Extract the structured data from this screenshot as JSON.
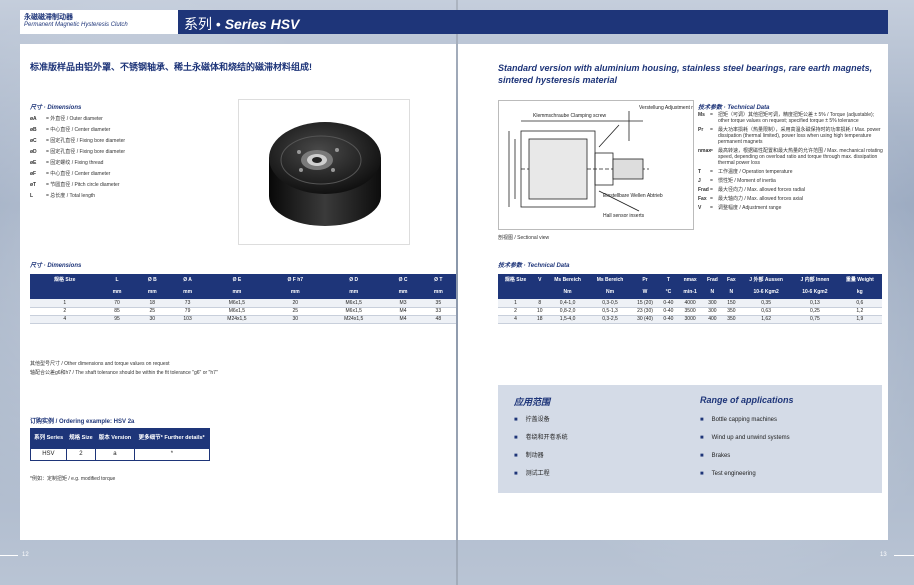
{
  "header": {
    "zh_label": "永磁磁滞制动器",
    "en_label": "Permanent Magnetic Hysteresis Clutch",
    "title_prefix": "系列 • ",
    "title_series": "Series HSV"
  },
  "intro": {
    "zh": "标准版样品由铝外罩、不锈钢轴承、稀土永磁体和烧结的磁滞材料组成!",
    "en": "Standard version with aluminium housing, stainless steel bearings, rare earth magnets, sintered hysteresis material"
  },
  "dimensions_legend": {
    "title": "尺寸 · Dimensions",
    "items": [
      {
        "sym": "øA",
        "text": "= 外直径 / Outer diameter"
      },
      {
        "sym": "øB",
        "text": "= 中心直径 / Center diameter"
      },
      {
        "sym": "øC",
        "text": "= 固定孔直径 / Fixing bore diameter"
      },
      {
        "sym": "øD",
        "text": "= 固定孔直径 / Fixing bore diameter"
      },
      {
        "sym": "øE",
        "text": "= 固定螺纹 / Fixing thread"
      },
      {
        "sym": "øF",
        "text": "= 中心直径 / Center diameter"
      },
      {
        "sym": "øT",
        "text": "= 节圆直径 / Pitch circle diameter"
      },
      {
        "sym": "L",
        "text": "= 总长度 / Total length"
      }
    ]
  },
  "drawing": {
    "labels": [
      "Verstellung Adjustment range",
      "Klemmschraube Clamping screw",
      "Einstellbare Wellen Abtrieb",
      "Hall sensor inserts"
    ],
    "caption": "剖视图 / Sectional view"
  },
  "tech_legend": {
    "title": "技术参数 · Technical Data",
    "items": [
      {
        "sym": "Ms",
        "text": "扭矩（可调）其他扭矩可调，精度扭矩公差 ± 5% / Torque (adjustable); other torque values on request; specified torque ± 5% tolerance"
      },
      {
        "sym": "Pr",
        "text": "最大功率损耗（热量限制），采用高温永磁保持时的功率损耗 / Max. power dissipation (thermal limited), power loss when using high temperature permanent magnets"
      },
      {
        "sym": "nmax",
        "text": "最高转速，根据磁性配置和最大热量的允许范围 / Max. mechanical rotating speed, depending on overload ratio and torque through max. dissipation thermal power loss"
      },
      {
        "sym": "T",
        "text": "工作温度 / Operation temperature"
      },
      {
        "sym": "J",
        "text": "惯性矩 / Moment of inertia"
      },
      {
        "sym": "Frad",
        "text": "最大径向力 / Max. allowed forces radial"
      },
      {
        "sym": "Fax",
        "text": "最大轴向力 / Max. allowed forces axial"
      },
      {
        "sym": "V",
        "text": "调整幅度 / Adjustment range"
      }
    ]
  },
  "dim_table": {
    "title": "尺寸 · Dimensions",
    "headers": [
      "规格 Size",
      "L",
      "Ø B",
      "Ø A",
      "Ø E",
      "Ø F h7",
      "Ø D",
      "Ø C",
      "Ø T"
    ],
    "units": [
      "",
      "mm",
      "mm",
      "mm",
      "mm",
      "mm",
      "mm",
      "mm",
      "mm"
    ],
    "rows": [
      [
        "1",
        "70",
        "18",
        "73",
        "M6x1,5",
        "20",
        "M6x1,5",
        "M3",
        "35"
      ],
      [
        "2",
        "85",
        "25",
        "79",
        "M6x1,5",
        "25",
        "M6x1,5",
        "M4",
        "33"
      ],
      [
        "4",
        "95",
        "30",
        "103",
        "M24x1,5",
        "30",
        "M24x1,5",
        "M4",
        "48"
      ]
    ]
  },
  "tech_table": {
    "title": "技术参数 · Technical Data",
    "headers": [
      "规格 Size",
      "V",
      "Ms Bereich",
      "Ms Bereich",
      "Pr",
      "T",
      "nmax",
      "Frad",
      "Fax",
      "J 外部 Aussen",
      "J 内部 Innen",
      "重量 Weight"
    ],
    "units": [
      "",
      "",
      "Nm",
      "Nm",
      "W",
      "°C",
      "min-1",
      "N",
      "N",
      "10-6 Kgm2",
      "10-6 Kgm2",
      "kg"
    ],
    "rows": [
      [
        "1",
        "8",
        "0,4-1,0",
        "0,3-0,5",
        "15 (20)",
        "0-40",
        "4000",
        "300",
        "150",
        "0,35",
        "0,13",
        "0,6"
      ],
      [
        "2",
        "10",
        "0,8-2,0",
        "0,5-1,3",
        "23 (30)",
        "0-40",
        "3500",
        "300",
        "350",
        "0,63",
        "0,25",
        "1,2"
      ],
      [
        "4",
        "18",
        "1,5-4,0",
        "0,3-2,5",
        "30 (40)",
        "0-40",
        "3000",
        "400",
        "350",
        "1,62",
        "0,75",
        "1,9"
      ]
    ]
  },
  "notes": [
    "其他型号尺寸 / Other dimensions and torque values on request",
    "轴配合公差g6和h7 / The shaft tolerance should be within the fit tolerance \"g6\" or \"h7\""
  ],
  "ordering": {
    "title": "订购实例 / Ordering example: HSV 2a",
    "headers": [
      "系列 Series",
      "规格 Size",
      "版本 Version",
      "更多细节* Further details*"
    ],
    "row": [
      "HSV",
      "2",
      "a",
      "*"
    ],
    "note": "*例如：定制扭矩 / e.g. modified torque"
  },
  "applications": {
    "zh_title": "应用范围",
    "en_title": "Range of applications",
    "zh_items": [
      "拧盖设备",
      "卷绕和开卷系统",
      "制动器",
      "测试工程"
    ],
    "en_items": [
      "Bottle capping machines",
      "Wind up and unwind systems",
      "Brakes",
      "Test engineering"
    ]
  },
  "page_numbers": {
    "left": "12",
    "right": "13"
  },
  "colors": {
    "brand": "#1e3579",
    "table_alt": "#eef1f6",
    "apps_bg": "#d4dbe7"
  }
}
